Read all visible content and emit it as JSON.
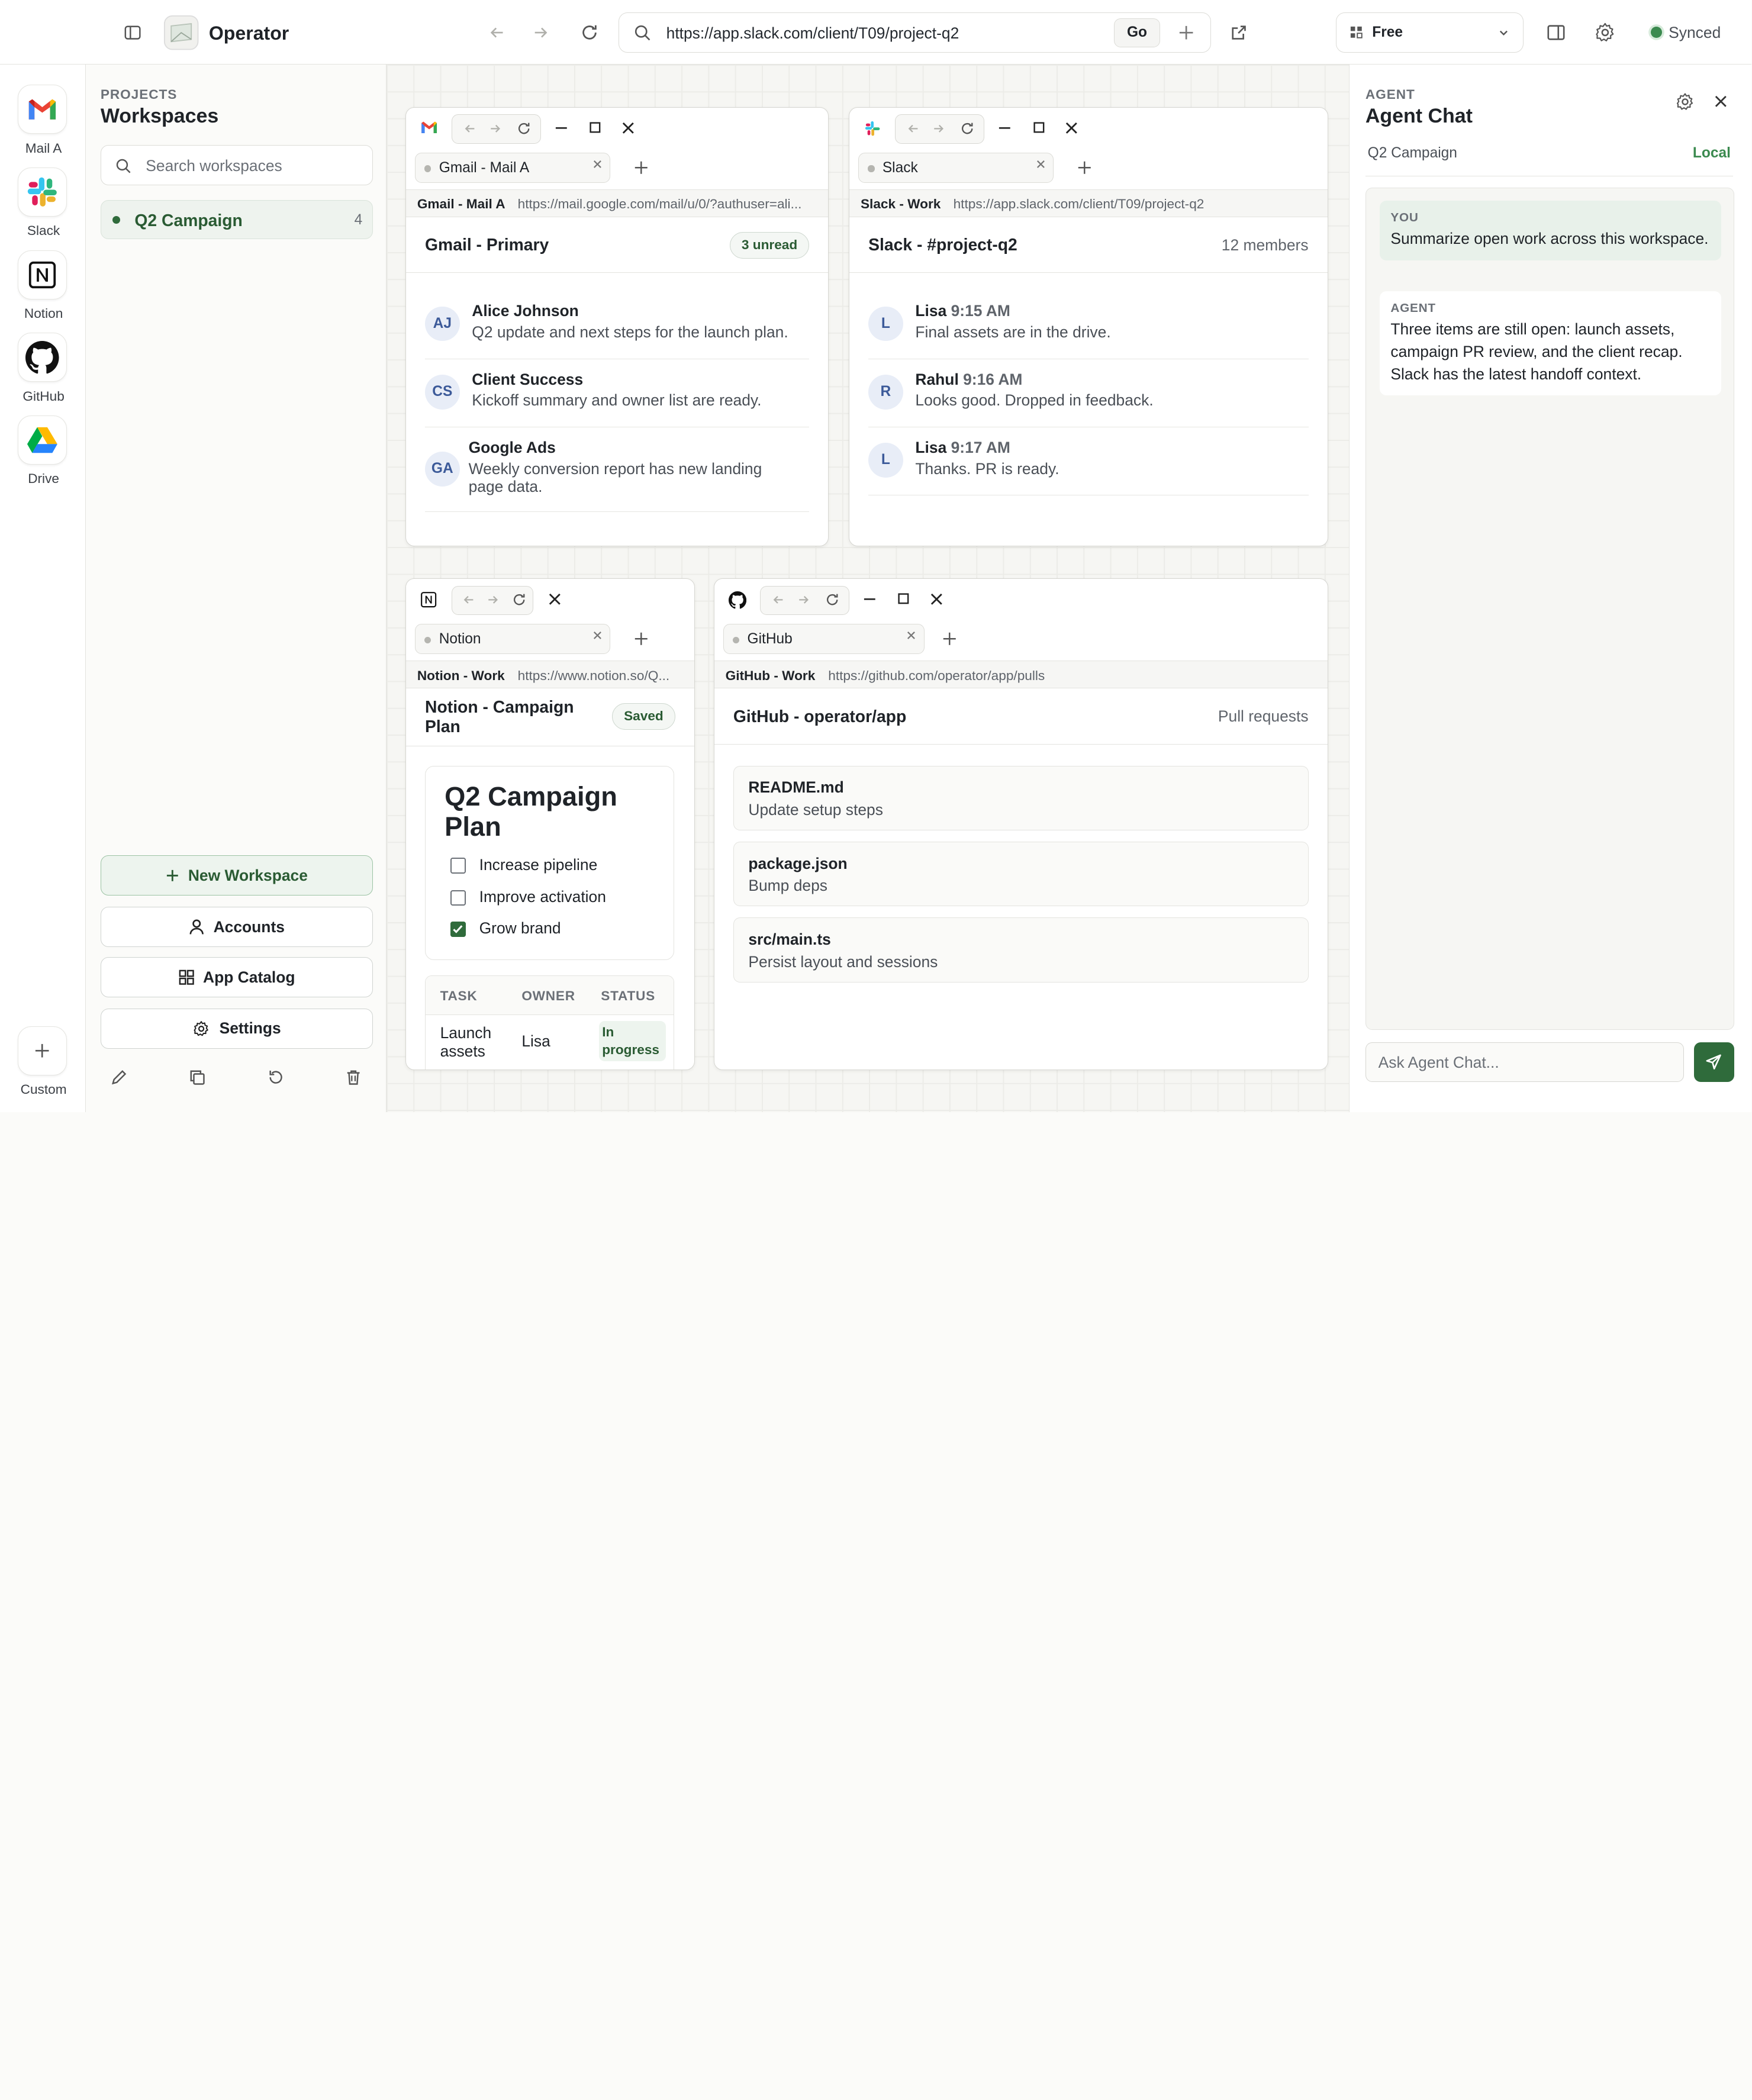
{
  "app": {
    "title": "Operator",
    "url": "https://app.slack.com/client/T09/project-q2",
    "go_label": "Go",
    "plan": "Free",
    "sync_status": "Synced"
  },
  "dock": {
    "items": [
      {
        "label": "Mail A",
        "icon": "gmail-icon"
      },
      {
        "label": "Slack",
        "icon": "slack-icon"
      },
      {
        "label": "Notion",
        "icon": "notion-icon"
      },
      {
        "label": "GitHub",
        "icon": "github-icon"
      },
      {
        "label": "Drive",
        "icon": "drive-icon"
      }
    ],
    "custom_label": "Custom"
  },
  "workspaces": {
    "kicker": "PROJECTS",
    "title": "Workspaces",
    "search_placeholder": "Search workspaces",
    "items": [
      {
        "name": "Q2 Campaign",
        "count": "4"
      }
    ],
    "buttons": {
      "new": "New Workspace",
      "accounts": "Accounts",
      "catalog": "App Catalog",
      "settings": "Settings"
    }
  },
  "windows": {
    "gmail": {
      "tab": "Gmail - Mail A",
      "addr_label": "Gmail - Mail A",
      "addr_url": "https://mail.google.com/mail/u/0/?authuser=ali...",
      "title": "Gmail - Primary",
      "badge": "3 unread",
      "rows": [
        {
          "initials": "AJ",
          "name": "Alice Johnson",
          "text": "Q2 update and next steps for the launch plan."
        },
        {
          "initials": "CS",
          "name": "Client Success",
          "text": "Kickoff summary and owner list are ready."
        },
        {
          "initials": "GA",
          "name": "Google Ads",
          "text": "Weekly conversion report has new landing page data."
        }
      ]
    },
    "slack": {
      "tab": "Slack",
      "addr_label": "Slack - Work",
      "addr_url": "https://app.slack.com/client/T09/project-q2",
      "title": "Slack - #project-q2",
      "meta": "12 members",
      "rows": [
        {
          "initials": "L",
          "name": "Lisa",
          "time": "9:15 AM",
          "text": "Final assets are in the drive."
        },
        {
          "initials": "R",
          "name": "Rahul",
          "time": "9:16 AM",
          "text": "Looks good. Dropped in feedback."
        },
        {
          "initials": "L",
          "name": "Lisa",
          "time": "9:17 AM",
          "text": "Thanks. PR is ready."
        }
      ]
    },
    "notion": {
      "tab": "Notion",
      "addr_label": "Notion - Work",
      "addr_url": "https://www.notion.so/Q...",
      "title": "Notion - Campaign Plan",
      "badge": "Saved",
      "doc_title": "Q2 Campaign Plan",
      "checks": [
        {
          "label": "Increase pipeline",
          "checked": false
        },
        {
          "label": "Improve activation",
          "checked": false
        },
        {
          "label": "Grow brand",
          "checked": true
        }
      ],
      "table": {
        "headers": [
          "TASK",
          "OWNER",
          "STATUS"
        ],
        "rows": [
          [
            "Launch assets",
            "Lisa",
            "In progress"
          ]
        ]
      }
    },
    "github": {
      "tab": "GitHub",
      "addr_label": "GitHub - Work",
      "addr_url": "https://github.com/operator/app/pulls",
      "title": "GitHub - operator/app",
      "meta": "Pull requests",
      "prs": [
        {
          "file": "README.md",
          "desc": "Update setup steps"
        },
        {
          "file": "package.json",
          "desc": "Bump deps"
        },
        {
          "file": "src/main.ts",
          "desc": "Persist layout and sessions"
        }
      ]
    }
  },
  "agent": {
    "kicker": "AGENT",
    "title": "Agent Chat",
    "context": "Q2 Campaign",
    "mode": "Local",
    "messages": [
      {
        "role": "YOU",
        "text": "Summarize open work across this workspace."
      },
      {
        "role": "AGENT",
        "text": "Three items are still open: launch assets, campaign PR review, and the client recap. Slack has the latest handoff context."
      }
    ],
    "input_placeholder": "Ask Agent Chat..."
  },
  "colors": {
    "accent": "#2f6b3b",
    "synced": "#3b8a4f"
  }
}
